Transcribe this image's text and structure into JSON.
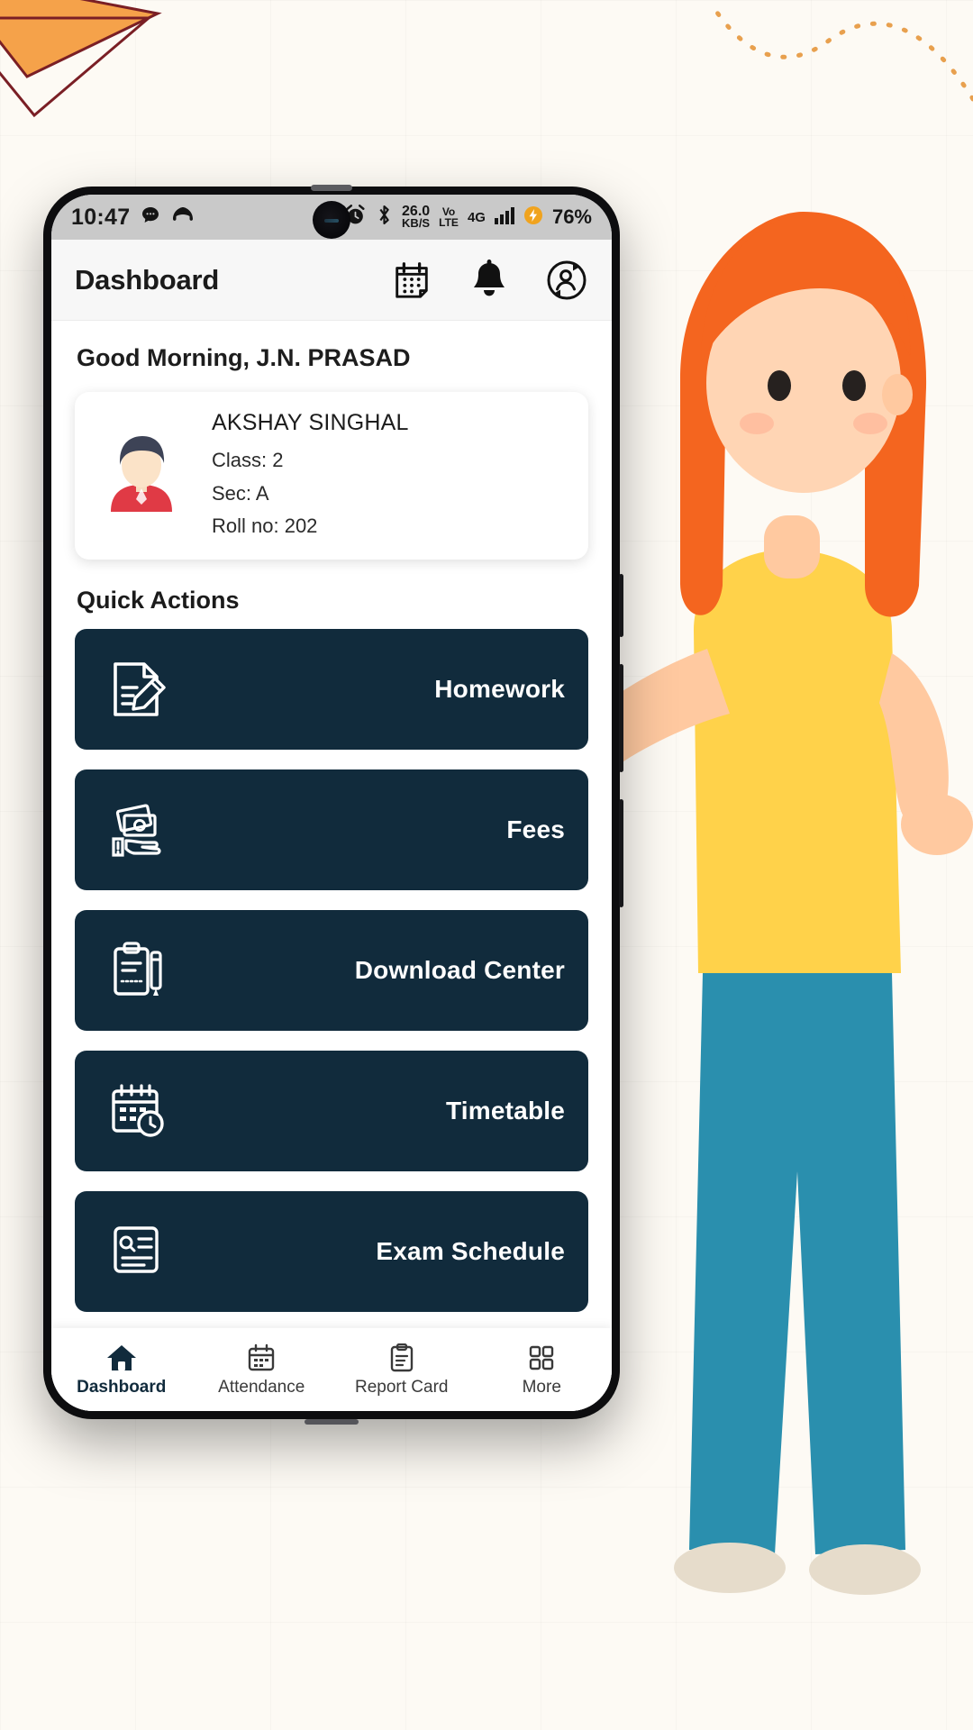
{
  "statusbar": {
    "time": "10:47",
    "icons_left": [
      "chat-bubble-icon",
      "missed-call-icon"
    ],
    "alarm_icon": "alarm-icon",
    "bluetooth_icon": "bluetooth-icon",
    "net_speed_value": "26.0",
    "net_speed_unit": "KB/S",
    "volte_top": "Vo",
    "volte_bottom": "LTE",
    "network_type": "4G",
    "signal_icon": "signal-bars-icon",
    "battery_icon": "battery-charging-icon",
    "battery_percent": "76%"
  },
  "appbar": {
    "title": "Dashboard",
    "icons": [
      {
        "name": "calendar-icon",
        "label": "Calendar"
      },
      {
        "name": "bell-icon",
        "label": "Notifications"
      },
      {
        "name": "switch-account-icon",
        "label": "Switch Student"
      }
    ]
  },
  "main": {
    "greeting": "Good Morning, J.N. PRASAD",
    "student": {
      "avatar": "student-avatar",
      "name": "AKSHAY SINGHAL",
      "class": "Class: 2",
      "section": "Sec: A",
      "roll": "Roll no: 202"
    },
    "quick_actions_title": "Quick Actions",
    "quick_actions": [
      {
        "label": "Homework",
        "icon": "homework-pencil-icon"
      },
      {
        "label": "Fees",
        "icon": "fees-money-hand-icon"
      },
      {
        "label": "Download Center",
        "icon": "clipboard-pen-icon"
      },
      {
        "label": "Timetable",
        "icon": "calendar-clock-icon"
      },
      {
        "label": "Exam Schedule",
        "icon": "exam-document-icon"
      }
    ]
  },
  "bottomnav": {
    "items": [
      {
        "label": "Dashboard",
        "icon": "home-icon",
        "active": true
      },
      {
        "label": "Attendance",
        "icon": "calendar-icon",
        "active": false
      },
      {
        "label": "Report Card",
        "icon": "clipboard-icon",
        "active": false
      },
      {
        "label": "More",
        "icon": "grid-dots-icon",
        "active": false
      }
    ]
  },
  "theme": {
    "card_navy": "#112b3c",
    "page_bg": "#fdfaf4",
    "statusbar_bg": "#c9c9c9",
    "accent_orange": "#f5a24a"
  }
}
